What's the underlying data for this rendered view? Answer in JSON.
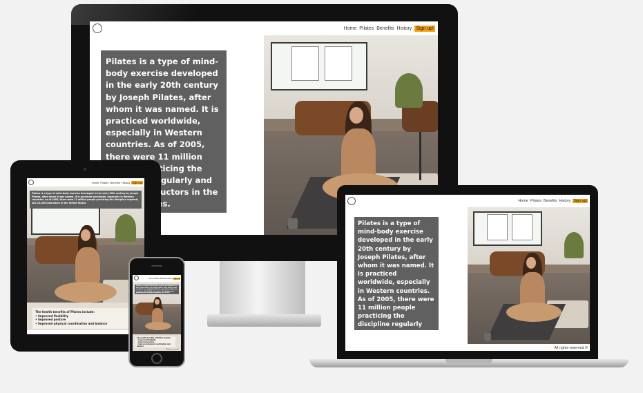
{
  "site": {
    "nav": {
      "home": "Home",
      "pilates": "Pilates",
      "benefits": "Benefits",
      "history": "History",
      "signup": "Sign up!"
    },
    "intro_text": "Pilates is a type of mind-body exercise developed in the early 20th century by Joseph Pilates, after whom it was named. It is practiced worldwide, especially in Western countries. As of 2005, there were 11 million people practicing the discipline regularly and 14,000 instructors in the United States.",
    "benefits": {
      "heading": "The health benefits of Pilates include:",
      "items": [
        "Improved flexibility",
        "Improved posture",
        "Improved physical coordination and balance"
      ]
    },
    "footer": "All rights reserved ©"
  },
  "monitor_text": {
    "line1": "Pilates is a type of mind-",
    "line2": "body exercise developed",
    "line3": "in the early 20th century",
    "line4": "by Joseph Pilates, after",
    "line5": "whom it was named. It is",
    "line6": "practiced worldwide,",
    "line7": "especially in Western",
    "line8": "countries. As of 2005,",
    "line9": "there were 11 million",
    "line10": "people practicing the",
    "line11": "discipline regularly and",
    "line12": "14,000 instructors in the",
    "line13": "United States."
  },
  "tablet_footer_visible": "All rights r",
  "colors": {
    "accent": "#f3a012",
    "info_box": "#606060",
    "bezel": "#111111",
    "background": "#f2f2f2"
  }
}
